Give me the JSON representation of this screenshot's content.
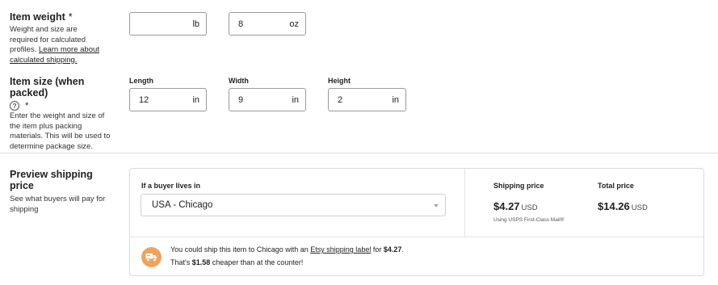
{
  "item_weight": {
    "title": "Item weight",
    "required_marker": "*",
    "description": "Weight and size are required for calculated profiles.",
    "learn_more_link": "Learn more about calculated shipping.",
    "lb_value": "",
    "lb_unit": "lb",
    "oz_value": "8",
    "oz_unit": "oz"
  },
  "item_size": {
    "title": "Item size (when packed)",
    "help_glyph": "?",
    "required_marker": "*",
    "description": "Enter the weight and size of the item plus packing materials. This will be used to determine package size.",
    "length_label": "Length",
    "length_value": "12",
    "width_label": "Width",
    "width_value": "9",
    "height_label": "Height",
    "height_value": "2",
    "unit": "in"
  },
  "preview": {
    "title": "Preview shipping price",
    "description": "See what buyers will pay for shipping",
    "location_label": "If a buyer lives in",
    "location_value": "USA - Chicago",
    "shipping_price_label": "Shipping price",
    "shipping_price": "$4.27",
    "shipping_currency": "USD",
    "carrier_note": "Using USPS First-Class Mail®",
    "total_price_label": "Total price",
    "total_price": "$14.26",
    "total_currency": "USD",
    "promo_part1": "You could ship this item to Chicago with an ",
    "promo_link": "Etsy shipping label",
    "promo_part2": " for ",
    "promo_amount": "$4.27",
    "promo_end": ".",
    "savings_part1": "That's ",
    "savings_amount": "$1.58",
    "savings_part2": " cheaper than at the counter!"
  },
  "colors": {
    "truck_badge": "#f1a25e",
    "border": "#9a9a9a",
    "divider": "#e2e2e2"
  },
  "icons": {
    "help": "help-circle-icon",
    "dropdown": "chevron-down-icon",
    "truck": "truck-icon"
  }
}
